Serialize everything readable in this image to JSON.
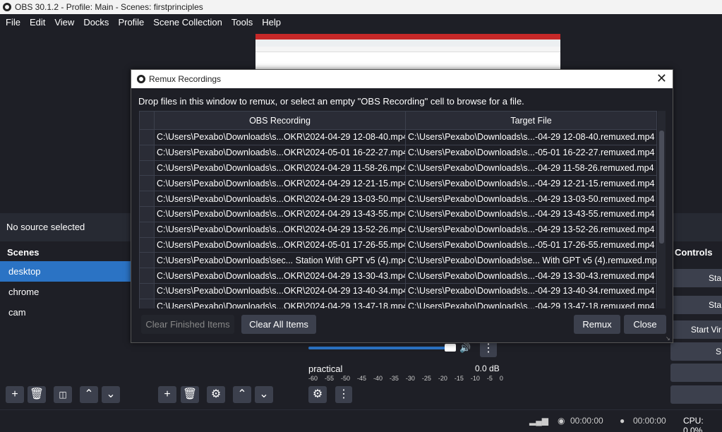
{
  "window": {
    "title": "OBS 30.1.2 - Profile: Main - Scenes: firstprinciples"
  },
  "menu": [
    "File",
    "Edit",
    "View",
    "Docks",
    "Profile",
    "Scene Collection",
    "Tools",
    "Help"
  ],
  "source_bar": {
    "text": "No source selected"
  },
  "scenes": {
    "header": "Scenes",
    "items": [
      "desktop",
      "chrome",
      "cam"
    ],
    "active": "desktop"
  },
  "controls": {
    "header": "Controls",
    "buttons": [
      "Sta",
      "Sta",
      "Start Vir",
      "S"
    ]
  },
  "mixer": {
    "source_name": "practical",
    "level": "0.0 dB",
    "scale": [
      "-60",
      "-55",
      "-50",
      "-45",
      "-40",
      "-35",
      "-30",
      "-25",
      "-20",
      "-15",
      "-10",
      "-5",
      "0"
    ]
  },
  "status": {
    "stream_time": "00:00:00",
    "record_time": "00:00:00",
    "cpu": "CPU: 0.0%"
  },
  "remux": {
    "title": "Remux Recordings",
    "instructions": "Drop files in this window to remux, or select an empty \"OBS Recording\" cell to browse for a file.",
    "columns": [
      "OBS Recording",
      "Target File"
    ],
    "rows": [
      [
        "C:\\Users\\Pexabo\\Downloads\\s...OKR\\2024-04-29 12-08-40.mp4",
        "C:\\Users\\Pexabo\\Downloads\\s...-04-29 12-08-40.remuxed.mp4"
      ],
      [
        "C:\\Users\\Pexabo\\Downloads\\s...OKR\\2024-05-01 16-22-27.mp4",
        "C:\\Users\\Pexabo\\Downloads\\s...-05-01 16-22-27.remuxed.mp4"
      ],
      [
        "C:\\Users\\Pexabo\\Downloads\\s...OKR\\2024-04-29 11-58-26.mp4",
        "C:\\Users\\Pexabo\\Downloads\\s...-04-29 11-58-26.remuxed.mp4"
      ],
      [
        "C:\\Users\\Pexabo\\Downloads\\s...OKR\\2024-04-29 12-21-15.mp4",
        "C:\\Users\\Pexabo\\Downloads\\s...-04-29 12-21-15.remuxed.mp4"
      ],
      [
        "C:\\Users\\Pexabo\\Downloads\\s...OKR\\2024-04-29 13-03-50.mp4",
        "C:\\Users\\Pexabo\\Downloads\\s...-04-29 13-03-50.remuxed.mp4"
      ],
      [
        "C:\\Users\\Pexabo\\Downloads\\s...OKR\\2024-04-29 13-43-55.mp4",
        "C:\\Users\\Pexabo\\Downloads\\s...-04-29 13-43-55.remuxed.mp4"
      ],
      [
        "C:\\Users\\Pexabo\\Downloads\\s...OKR\\2024-04-29 13-52-26.mp4",
        "C:\\Users\\Pexabo\\Downloads\\s...-04-29 13-52-26.remuxed.mp4"
      ],
      [
        "C:\\Users\\Pexabo\\Downloads\\s...OKR\\2024-05-01 17-26-55.mp4",
        "C:\\Users\\Pexabo\\Downloads\\s...-05-01 17-26-55.remuxed.mp4"
      ],
      [
        "C:\\Users\\Pexabo\\Downloads\\sec... Station  With GPT v5 (4).mp4",
        "C:\\Users\\Pexabo\\Downloads\\se... With GPT v5 (4).remuxed.mp4"
      ],
      [
        "C:\\Users\\Pexabo\\Downloads\\s...OKR\\2024-04-29 13-30-43.mp4",
        "C:\\Users\\Pexabo\\Downloads\\s...-04-29 13-30-43.remuxed.mp4"
      ],
      [
        "C:\\Users\\Pexabo\\Downloads\\s...OKR\\2024-04-29 13-40-34.mp4",
        "C:\\Users\\Pexabo\\Downloads\\s...-04-29 13-40-34.remuxed.mp4"
      ],
      [
        "C:\\Users\\Pexabo\\Downloads\\s...OKR\\2024-04-29 13-47-18.mp4",
        "C:\\Users\\Pexabo\\Downloads\\s...-04-29 13-47-18.remuxed.mp4"
      ]
    ],
    "buttons": {
      "clear_finished": "Clear Finished Items",
      "clear_all": "Clear All Items",
      "remux": "Remux",
      "close": "Close"
    }
  },
  "colors": {
    "accent": "#2b73c4",
    "background": "#1e1f26",
    "button": "#3c404d"
  }
}
